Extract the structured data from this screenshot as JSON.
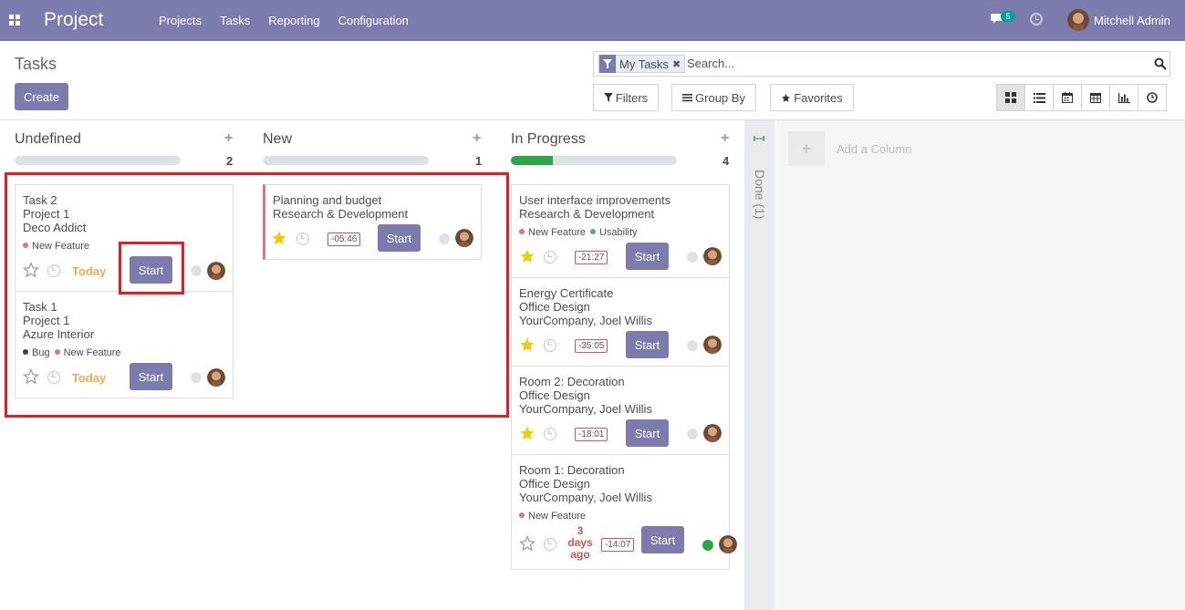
{
  "nav": {
    "brand": "Project",
    "menu": [
      "Projects",
      "Tasks",
      "Reporting",
      "Configuration"
    ],
    "chat_count": "5",
    "user": "Mitchell Admin"
  },
  "control_panel": {
    "title": "Tasks",
    "create_label": "Create",
    "facet_label": "My Tasks",
    "facet_close": "✖",
    "search_placeholder": "Search...",
    "filters_label": "Filters",
    "groupby_label": "Group By",
    "favorites_label": "Favorites"
  },
  "columns": [
    {
      "title": "Undefined",
      "count": "2",
      "progress": 0,
      "cards": [
        {
          "lines": [
            "Task 2",
            "Project 1",
            "Deco Addict"
          ],
          "tags": [
            {
              "label": "New Feature",
              "color": "#e57373"
            }
          ],
          "starred": false,
          "date": "Today",
          "date_type": "today",
          "button": "Start",
          "status": "grey"
        },
        {
          "lines": [
            "Task 1",
            "Project 1",
            "Azure Interior"
          ],
          "tags": [
            {
              "label": "Bug",
              "color": "#374357"
            },
            {
              "label": "New Feature",
              "color": "#e57373"
            }
          ],
          "starred": false,
          "date": "Today",
          "date_type": "today",
          "button": "Start",
          "status": "grey"
        }
      ]
    },
    {
      "title": "New",
      "count": "1",
      "progress": 0,
      "cards": [
        {
          "lines": [
            "Planning and budget",
            "Research & Development"
          ],
          "tags": [],
          "starred": true,
          "date": "-05:46",
          "date_type": "timer",
          "button": "Start",
          "status": "grey"
        }
      ]
    },
    {
      "title": "In Progress",
      "count": "4",
      "progress": 0.25,
      "cards": [
        {
          "lines": [
            "User interface improvements",
            "Research & Development"
          ],
          "tags": [
            {
              "label": "New Feature",
              "color": "#e57373"
            },
            {
              "label": "Usability",
              "color": "#4caf82"
            }
          ],
          "starred": true,
          "date": "-21:27",
          "date_type": "timer",
          "button": "Start",
          "status": "grey"
        },
        {
          "lines": [
            "Energy Certificate",
            "Office Design",
            "YourCompany, Joel Willis"
          ],
          "tags": [],
          "starred": true,
          "date": "-35:05",
          "date_type": "timer",
          "button": "Start",
          "status": "grey"
        },
        {
          "lines": [
            "Room 2: Decoration",
            "Office Design",
            "YourCompany, Joel Willis"
          ],
          "tags": [],
          "starred": true,
          "date": "-18:01",
          "date_type": "timer",
          "button": "Start",
          "status": "grey"
        },
        {
          "lines": [
            "Room 1: Decoration",
            "Office Design",
            "YourCompany, Joel Willis"
          ],
          "tags": [
            {
              "label": "New Feature",
              "color": "#e57373"
            }
          ],
          "starred": false,
          "overdue": [
            "3",
            "days",
            "ago"
          ],
          "date": "-14:07",
          "date_type": "timer",
          "button": "Start",
          "status": "green"
        }
      ]
    }
  ],
  "folded_column": {
    "label": "Done (1)"
  },
  "add_column": {
    "plus": "+",
    "label": "Add a Column"
  },
  "colors": {
    "brand": "#7c7bad",
    "star_active": "#f3cc00",
    "today": "#f0ad4e",
    "danger": "#d9534f",
    "highlight": "#e51c23"
  }
}
